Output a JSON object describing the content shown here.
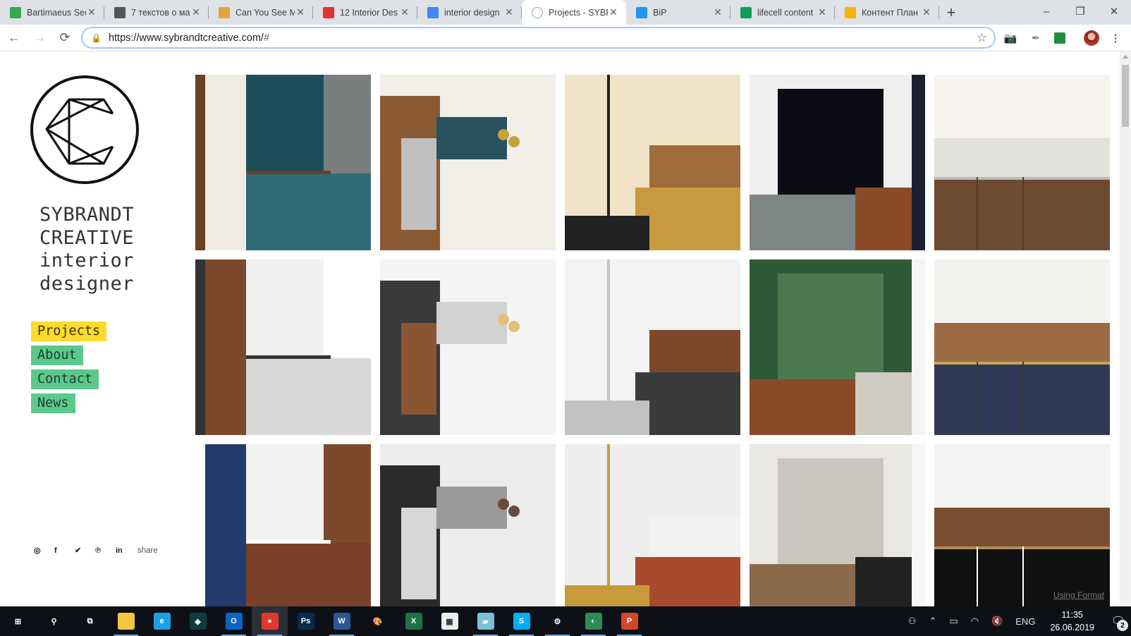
{
  "browser": {
    "tabs": [
      {
        "title": "Bartimaeus Sec",
        "icon": "google-drive-icon",
        "color": "#34a853"
      },
      {
        "title": "7 текстов о ма",
        "icon": "pen-icon",
        "color": "#555555"
      },
      {
        "title": "Can You See M",
        "icon": "chart-icon",
        "color": "#e8a33a"
      },
      {
        "title": "12 Interior Des",
        "icon": "red-square-icon",
        "color": "#e3342f"
      },
      {
        "title": "interior design",
        "icon": "google-docs-icon",
        "color": "#4285f4"
      },
      {
        "title": "Projects - SYBR",
        "icon": "site-icon",
        "color": "#9aa0a6",
        "active": true
      },
      {
        "title": "BiP",
        "icon": "bip-icon",
        "color": "#2196f3"
      },
      {
        "title": "lifecell content",
        "icon": "google-sheets-icon",
        "color": "#0f9d58"
      },
      {
        "title": "Контент План",
        "icon": "google-slides-icon",
        "color": "#f4b400"
      }
    ],
    "new_tab": "+",
    "close_glyph": "✕",
    "window": {
      "minimize": "–",
      "restore": "❐",
      "close": "✕"
    },
    "url_scheme_host": "https://www.sybrandtcreative.com/",
    "url_fragment": "#",
    "nav": {
      "back": "←",
      "forward": "→",
      "reload": "⟳"
    }
  },
  "site": {
    "brand_lines": [
      "SYBRANDT",
      "CREATIVE",
      "interior",
      "designer"
    ],
    "menu": [
      {
        "label": "Projects",
        "active": true
      },
      {
        "label": "About"
      },
      {
        "label": "Contact"
      },
      {
        "label": "News"
      }
    ],
    "social": [
      "instagram",
      "facebook",
      "twitter",
      "pinterest",
      "linkedin"
    ],
    "social_glyphs": [
      "◎",
      "f",
      "🐦",
      "℗",
      "in"
    ],
    "share_label": "share",
    "colors": {
      "menu_active": "#fddb2c",
      "menu_default": "#5bc98c"
    },
    "projects": [
      {
        "name": "teal-hex-tile-kitchen",
        "palette": [
          "#1c4e5c",
          "#2f6b78",
          "#efeae2",
          "#6b3f22",
          "#7a7f7d"
        ]
      },
      {
        "name": "walnut-kitchen-pendants",
        "palette": [
          "#f2efe9",
          "#8a5a34",
          "#c0c0c0",
          "#28525e",
          "#c8a23a"
        ]
      },
      {
        "name": "gold-line-staircase",
        "palette": [
          "#f1e3c7",
          "#c89a3e",
          "#a06c3a",
          "#222222",
          "#e8dcc5"
        ]
      },
      {
        "name": "tv-marble-fireplace",
        "palette": [
          "#efefef",
          "#0c0c14",
          "#7e8683",
          "#8a4a28",
          "#1a2030"
        ]
      },
      {
        "name": "white-walnut-kitchen",
        "palette": [
          "#f6f3ee",
          "#e3e1dc",
          "#6e4a30",
          "#5a3b26",
          "#bbbbbb"
        ]
      },
      {
        "name": "floating-walnut-vanity",
        "palette": [
          "#f0f0f0",
          "#d8d8d8",
          "#7b4a2c",
          "#333333",
          "#ffffff"
        ]
      },
      {
        "name": "island-stools-pendants",
        "palette": [
          "#f4f4f2",
          "#3a3a3a",
          "#8a5533",
          "#d1d1d1",
          "#e2c07a"
        ]
      },
      {
        "name": "stool-closeup-kitchen",
        "palette": [
          "#f3f3f3",
          "#3b3b3b",
          "#7c4a2a",
          "#c2c2c2",
          "#d8b35a"
        ]
      },
      {
        "name": "green-leaf-powder-room",
        "palette": [
          "#2f5a38",
          "#4c7a50",
          "#8a4a2a",
          "#cfcac2",
          "#f4f4f4"
        ]
      },
      {
        "name": "white-oven-kitchen",
        "palette": [
          "#f4f2ee",
          "#9a6a42",
          "#2e3a55",
          "#3a3a3a",
          "#c9a45a"
        ]
      },
      {
        "name": "navy-walnut-kitchen",
        "palette": [
          "#f1f1f1",
          "#7a4128",
          "#253a6e",
          "#ffffff",
          "#7b4a2c"
        ]
      },
      {
        "name": "living-room-sofa",
        "palette": [
          "#ececec",
          "#2b2b2b",
          "#d7d7d7",
          "#9a9a9a",
          "#6a4a3a"
        ]
      },
      {
        "name": "globe-pendants-brick",
        "palette": [
          "#eeeeee",
          "#a84a2c",
          "#f2f2f2",
          "#c79a3a",
          "#d8a88a"
        ]
      },
      {
        "name": "bright-kitchen-island",
        "palette": [
          "#e9e7e3",
          "#c9c6c0",
          "#8a6a4a",
          "#222222",
          "#f6f6f6"
        ]
      },
      {
        "name": "walnut-shelves-tv",
        "palette": [
          "#f3f3f3",
          "#7a4e30",
          "#101010",
          "#ffffff",
          "#b38a5a"
        ]
      }
    ]
  },
  "page_hint": "Using Format",
  "taskbar": {
    "apps": [
      {
        "name": "start",
        "glyph": "⊞",
        "color": "#0d1117"
      },
      {
        "name": "search",
        "glyph": "⚲",
        "color": "#0d1117"
      },
      {
        "name": "task-view",
        "glyph": "⧉",
        "color": "#0d1117"
      },
      {
        "name": "file-explorer",
        "glyph": "",
        "color": "#f4c542",
        "running": true
      },
      {
        "name": "internet-explorer",
        "glyph": "e",
        "color": "#1ea0e6"
      },
      {
        "name": "app-blue",
        "glyph": "◈",
        "color": "#0e3b40"
      },
      {
        "name": "outlook",
        "glyph": "O",
        "color": "#0a64c2",
        "running": true
      },
      {
        "name": "chrome",
        "glyph": "●",
        "color": "#e0392b",
        "running": true,
        "active": true
      },
      {
        "name": "photoshop",
        "glyph": "Ps",
        "color": "#062b4c"
      },
      {
        "name": "word",
        "glyph": "W",
        "color": "#2b5797",
        "running": true
      },
      {
        "name": "paint",
        "glyph": "🎨",
        "color": "#0d1117"
      },
      {
        "name": "excel",
        "glyph": "X",
        "color": "#1e7145"
      },
      {
        "name": "calculator",
        "glyph": "▦",
        "color": "#eeeeee"
      },
      {
        "name": "notes",
        "glyph": "▰",
        "color": "#79c1d8",
        "running": true
      },
      {
        "name": "skype",
        "glyph": "S",
        "color": "#00aff0",
        "running": true
      },
      {
        "name": "settings",
        "glyph": "⚙",
        "color": "#0d1117",
        "running": true
      },
      {
        "name": "network-app",
        "glyph": "◐",
        "color": "#2e8b57",
        "running": true
      },
      {
        "name": "powerpoint",
        "glyph": "P",
        "color": "#d24726",
        "running": true
      }
    ],
    "tray": {
      "people": "⚇",
      "chevron": "⌃",
      "battery": "▭",
      "wifi": "◠",
      "volume": "🔇",
      "language": "ENG",
      "time": "11:35",
      "date": "26.06.2019",
      "notifications": "2"
    }
  }
}
